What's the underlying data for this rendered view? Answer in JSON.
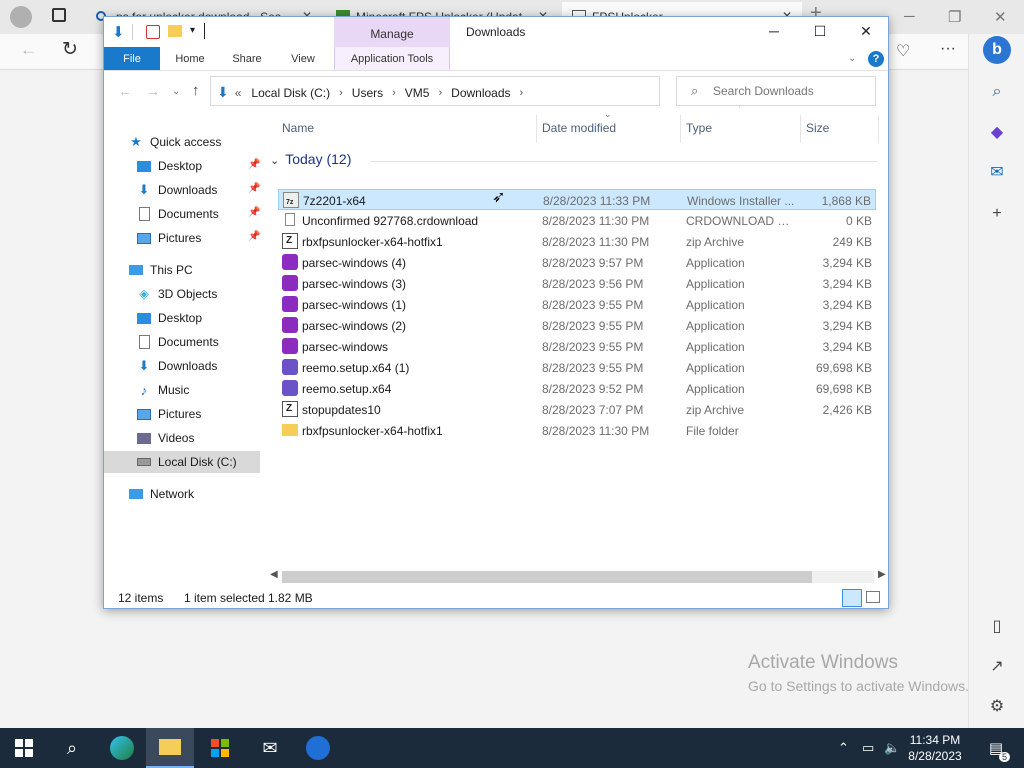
{
  "browser": {
    "tabs": [
      {
        "title": "ps for unlocker download - Sea"
      },
      {
        "title": "Minecraft FPS Unlocker (Updat"
      },
      {
        "title": "FPSUnlocker"
      }
    ],
    "new_tab": "+",
    "window_controls": {
      "minimize": "─",
      "restore": "❐",
      "close": "✕"
    },
    "toolbar": {
      "back": "←",
      "reload": "↻",
      "more": "···"
    },
    "activation": {
      "line1": "Activate Windows",
      "line2": "Go to Settings to activate Windows."
    }
  },
  "explorer": {
    "title": "Downloads",
    "context_tab_header": "Manage",
    "ribbon_tabs": {
      "file": "File",
      "home": "Home",
      "share": "Share",
      "view": "View",
      "app_tools": "Application Tools"
    },
    "window_controls": {
      "minimize": "─",
      "maximize": "☐",
      "close": "✕"
    },
    "nav": {
      "back": "←",
      "forward": "→",
      "up": "↑"
    },
    "address": {
      "overflow": "«",
      "crumbs": [
        "Local Disk (C:)",
        "Users",
        "VM5",
        "Downloads"
      ],
      "separator": "›"
    },
    "search": {
      "placeholder": "Search Downloads"
    },
    "nav_pane": {
      "quick_access": "Quick access",
      "quick_items": [
        "Desktop",
        "Downloads",
        "Documents",
        "Pictures"
      ],
      "this_pc": "This PC",
      "pc_items": [
        "3D Objects",
        "Desktop",
        "Documents",
        "Downloads",
        "Music",
        "Pictures",
        "Videos",
        "Local Disk (C:)"
      ],
      "network": "Network"
    },
    "columns": {
      "name": "Name",
      "date": "Date modified",
      "type": "Type",
      "size": "Size"
    },
    "group": {
      "label": "Today (12)"
    },
    "files": [
      {
        "name": "7z2201-x64",
        "date": "8/28/2023 11:33 PM",
        "type": "Windows Installer ...",
        "size": "1,868 KB",
        "icon": "installer-icon"
      },
      {
        "name": "Unconfirmed 927768.crdownload",
        "date": "8/28/2023 11:30 PM",
        "type": "CRDOWNLOAD File",
        "size": "0 KB",
        "icon": "blank-file-icon"
      },
      {
        "name": "rbxfpsunlocker-x64-hotfix1",
        "date": "8/28/2023 11:30 PM",
        "type": "zip Archive",
        "size": "249 KB",
        "icon": "zip-icon"
      },
      {
        "name": "parsec-windows (4)",
        "date": "8/28/2023 9:57 PM",
        "type": "Application",
        "size": "3,294 KB",
        "icon": "parsec-icon"
      },
      {
        "name": "parsec-windows (3)",
        "date": "8/28/2023 9:56 PM",
        "type": "Application",
        "size": "3,294 KB",
        "icon": "parsec-icon"
      },
      {
        "name": "parsec-windows (1)",
        "date": "8/28/2023 9:55 PM",
        "type": "Application",
        "size": "3,294 KB",
        "icon": "parsec-icon"
      },
      {
        "name": "parsec-windows (2)",
        "date": "8/28/2023 9:55 PM",
        "type": "Application",
        "size": "3,294 KB",
        "icon": "parsec-icon"
      },
      {
        "name": "parsec-windows",
        "date": "8/28/2023 9:55 PM",
        "type": "Application",
        "size": "3,294 KB",
        "icon": "parsec-icon"
      },
      {
        "name": "reemo.setup.x64 (1)",
        "date": "8/28/2023 9:55 PM",
        "type": "Application",
        "size": "69,698 KB",
        "icon": "reemo-icon"
      },
      {
        "name": "reemo.setup.x64",
        "date": "8/28/2023 9:52 PM",
        "type": "Application",
        "size": "69,698 KB",
        "icon": "reemo-icon"
      },
      {
        "name": "stopupdates10",
        "date": "8/28/2023 7:07 PM",
        "type": "zip Archive",
        "size": "2,426 KB",
        "icon": "zip-icon"
      },
      {
        "name": "rbxfpsunlocker-x64-hotfix1",
        "date": "8/28/2023 11:30 PM",
        "type": "File folder",
        "size": "",
        "icon": "folder-icon"
      }
    ],
    "status": {
      "count": "12 items",
      "selected": "1 item selected",
      "size": "1.82 MB"
    }
  },
  "taskbar": {
    "time": "11:34 PM",
    "date": "8/28/2023",
    "notification_count": "5"
  },
  "colors": {
    "accent": "#1979ca",
    "selection": "#cce8ff",
    "manage_tab": "#e9d8f5",
    "taskbar": "#1c2b3c",
    "parsec": "#8b2bbf",
    "reemo": "#6b52c7"
  }
}
